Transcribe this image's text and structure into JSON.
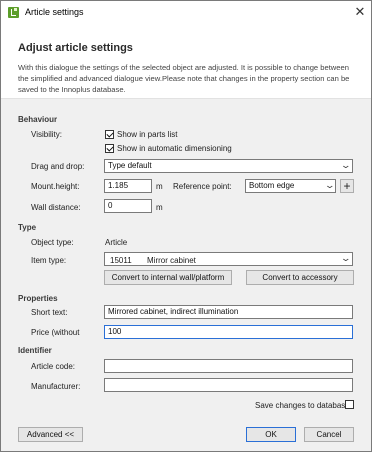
{
  "window": {
    "title": "Article settings",
    "close_glyph": "✕",
    "app_icon": "app-logo-icon"
  },
  "header": {
    "title": "Adjust article settings",
    "description": "With this dialogue the settings of the selected object are adjusted. It is possible to change between the simplified and advanced dialogue view.Please note that changes in the property section can be saved to the Innoplus database."
  },
  "behaviour": {
    "section_label": "Behaviour",
    "visibility_label": "Visibility:",
    "show_in_parts_list": {
      "label": "Show in parts list",
      "checked": true
    },
    "show_in_auto_dim": {
      "label": "Show in automatic dimensioning",
      "checked": true
    },
    "drag_drop_label": "Drag and drop:",
    "drag_drop_value": "Type default",
    "mount_height_label": "Mount.height:",
    "mount_height_value": "1.185",
    "mount_height_unit": "m",
    "reference_point_label": "Reference point:",
    "reference_point_value": "Bottom edge",
    "wall_distance_label": "Wall distance:",
    "wall_distance_value": "0",
    "wall_distance_unit": "m"
  },
  "type": {
    "section_label": "Type",
    "object_type_label": "Object type:",
    "object_type_value": "Article",
    "item_type_label": "Item type:",
    "item_type_code": "15011",
    "item_type_name": "Mirror cabinet",
    "convert_wall_label": "Convert to internal wall/platform",
    "convert_accessory_label": "Convert to accessory"
  },
  "properties": {
    "section_label": "Properties",
    "short_text_label": "Short text:",
    "short_text_value": "Mirrored cabinet, indirect illumination",
    "price_label": "Price (without",
    "price_value": "100"
  },
  "identifier": {
    "section_label": "Identifier",
    "article_code_label": "Article code:",
    "article_code_value": "",
    "manufacturer_label": "Manufacturer:",
    "manufacturer_value": ""
  },
  "footer": {
    "save_db_label": "Save changes to database",
    "save_db_checked": false,
    "advanced_label": "Advanced <<",
    "ok_label": "OK",
    "cancel_label": "Cancel"
  }
}
